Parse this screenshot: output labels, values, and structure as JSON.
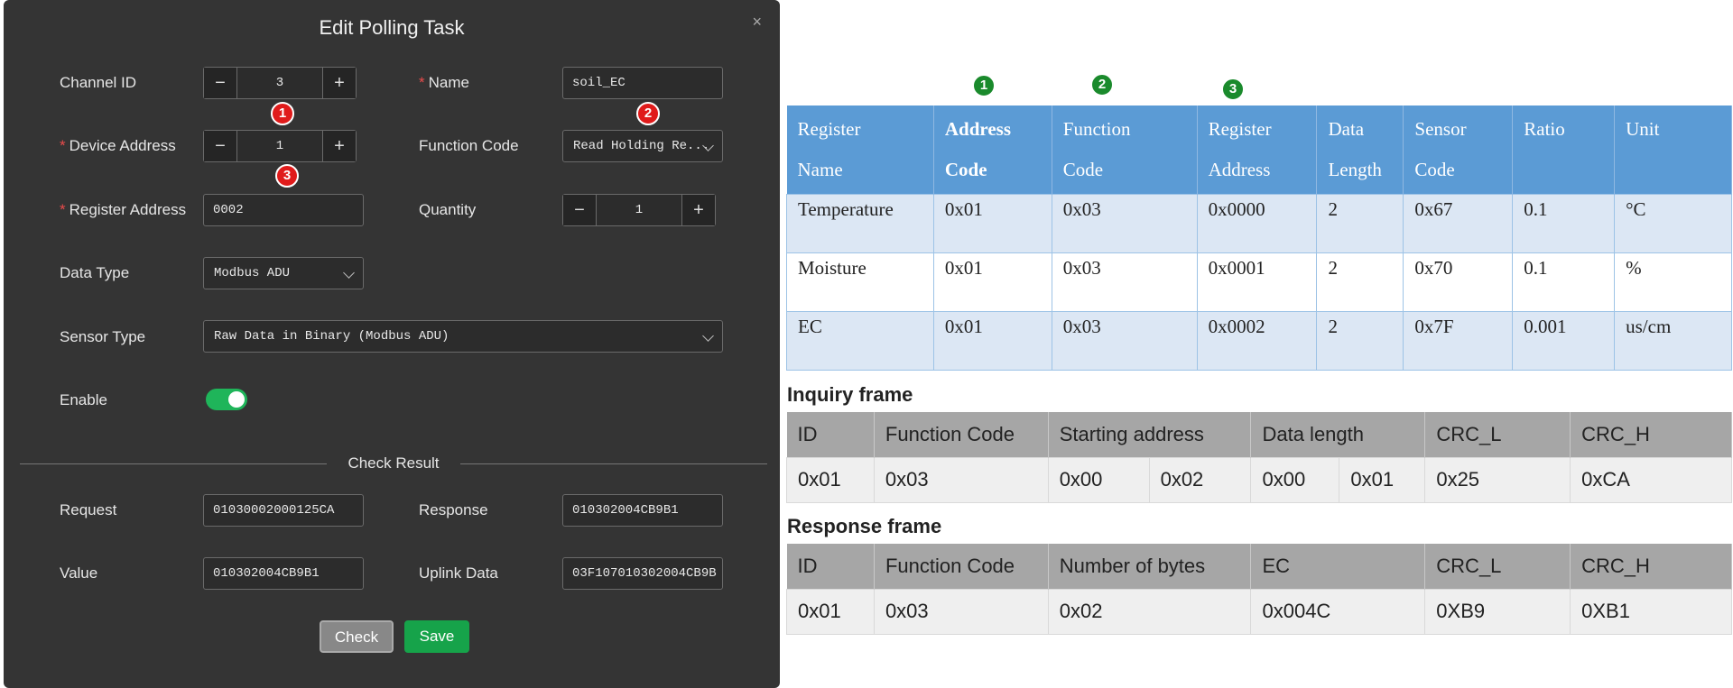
{
  "dialog": {
    "title": "Edit Polling Task",
    "close_glyph": "×",
    "required_mark": "*",
    "channel_id": {
      "label": "Channel ID",
      "value": "3",
      "minus": "−",
      "plus": "+"
    },
    "name": {
      "label": "Name",
      "value": "soil_EC"
    },
    "device_address": {
      "label": "Device Address",
      "value": "1",
      "minus": "−",
      "plus": "+"
    },
    "function_code": {
      "label": "Function Code",
      "value": "Read Holding Re..."
    },
    "register_address": {
      "label": "Register Address",
      "value": "0002"
    },
    "quantity": {
      "label": "Quantity",
      "value": "1",
      "minus": "−",
      "plus": "+"
    },
    "data_type": {
      "label": "Data Type",
      "value": "Modbus ADU"
    },
    "sensor_type": {
      "label": "Sensor Type",
      "value": "Raw Data in Binary (Modbus ADU)"
    },
    "enable": {
      "label": "Enable",
      "on": true
    },
    "check_result": {
      "title": "Check Result",
      "request": {
        "label": "Request",
        "value": "01030002000125CA"
      },
      "response": {
        "label": "Response",
        "value": "010302004CB9B1"
      },
      "value": {
        "label": "Value",
        "value": "010302004CB9B1"
      },
      "uplink": {
        "label": "Uplink Data",
        "value": "03F107010302004CB9B"
      }
    },
    "buttons": {
      "check": "Check",
      "save": "Save"
    },
    "badges": [
      "1",
      "2",
      "3"
    ]
  },
  "register_table": {
    "annotations": [
      "1",
      "2",
      "3"
    ],
    "headers": [
      [
        "Register",
        "Name"
      ],
      [
        "Address",
        "Code"
      ],
      [
        "Function",
        "Code"
      ],
      [
        "Register",
        "Address"
      ],
      [
        "Data",
        "Length"
      ],
      [
        "Sensor",
        "Code"
      ],
      [
        "Ratio",
        ""
      ],
      [
        "Unit",
        ""
      ]
    ],
    "rows": [
      [
        "Temperature",
        "0x01",
        "0x03",
        "0x0000",
        "2",
        "0x67",
        "0.1",
        "°C"
      ],
      [
        "Moisture",
        "0x01",
        "0x03",
        "0x0001",
        "2",
        "0x70",
        "0.1",
        "%"
      ],
      [
        "EC",
        "0x01",
        "0x03",
        "0x0002",
        "2",
        "0x7F",
        "0.001",
        "us/cm"
      ]
    ]
  },
  "inquiry_frame": {
    "title": "Inquiry frame",
    "headers": [
      "ID",
      "Function Code",
      "Starting address",
      "Data length",
      "CRC_L",
      "CRC_H"
    ],
    "values": [
      "0x01",
      "0x03",
      "0x00",
      "0x02",
      "0x00",
      "0x01",
      "0x25",
      "0xCA"
    ]
  },
  "response_frame": {
    "title": "Response frame",
    "headers": [
      "ID",
      "Function Code",
      "Number of bytes",
      "EC",
      "CRC_L",
      "CRC_H"
    ],
    "values": [
      "0x01",
      "0x03",
      "0x02",
      "0x004C",
      "0XB9",
      "0XB1"
    ]
  },
  "colors": {
    "dialog_bg": "#343434",
    "accent_green": "#16a34a",
    "badge_red": "#e01b1b",
    "badge_green": "#1a8a2c",
    "table_header_blue": "#5b9bd5",
    "table_row_blue": "#dce7f4",
    "frame_header_gray": "#a6a6a6"
  }
}
